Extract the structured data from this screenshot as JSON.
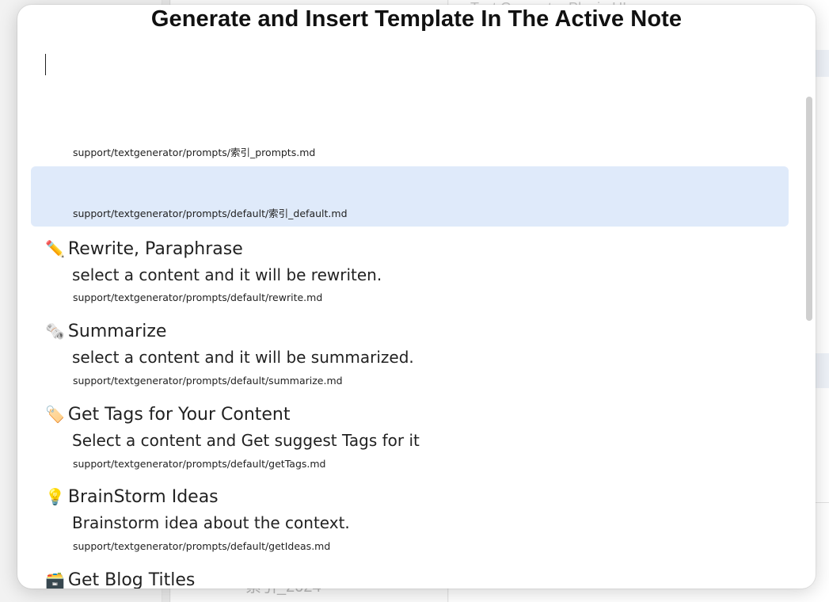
{
  "background": {
    "peek_title": "Text Generator Plugin UI",
    "peek_text": "索引_2024"
  },
  "modal": {
    "title": "Generate and Insert Template In The Active Note",
    "search": {
      "value": "",
      "placeholder": ""
    }
  },
  "results": [
    {
      "title": "",
      "emoji": "",
      "desc": "",
      "path": "support/textgenerator/prompts/索引_prompts.md",
      "selected": false
    },
    {
      "title": "",
      "emoji": "",
      "desc": "",
      "path": "support/textgenerator/prompts/default/索引_default.md",
      "selected": true
    },
    {
      "emoji": "✏️",
      "title": "Rewrite, Paraphrase",
      "desc": "select a content and it will be rewriten.",
      "path": "support/textgenerator/prompts/default/rewrite.md",
      "selected": false
    },
    {
      "emoji": "🗞️",
      "title": "Summarize",
      "desc": "select a content and it will be summarized.",
      "path": "support/textgenerator/prompts/default/summarize.md",
      "selected": false
    },
    {
      "emoji": "🏷️",
      "title": "Get Tags for Your Content",
      "desc": "Select a content and Get suggest Tags for it",
      "path": "support/textgenerator/prompts/default/getTags.md",
      "selected": false
    },
    {
      "emoji": "💡",
      "title": "BrainStorm Ideas",
      "desc": "Brainstorm idea about the context.",
      "path": "support/textgenerator/prompts/default/getIdeas.md",
      "selected": false
    },
    {
      "emoji": "🗃️",
      "title": "Get Blog Titles",
      "desc": "",
      "path": "",
      "selected": false
    }
  ],
  "colors": {
    "selected_bg": "#dfeafa",
    "modal_bg": "#ffffff",
    "text": "#222222"
  }
}
